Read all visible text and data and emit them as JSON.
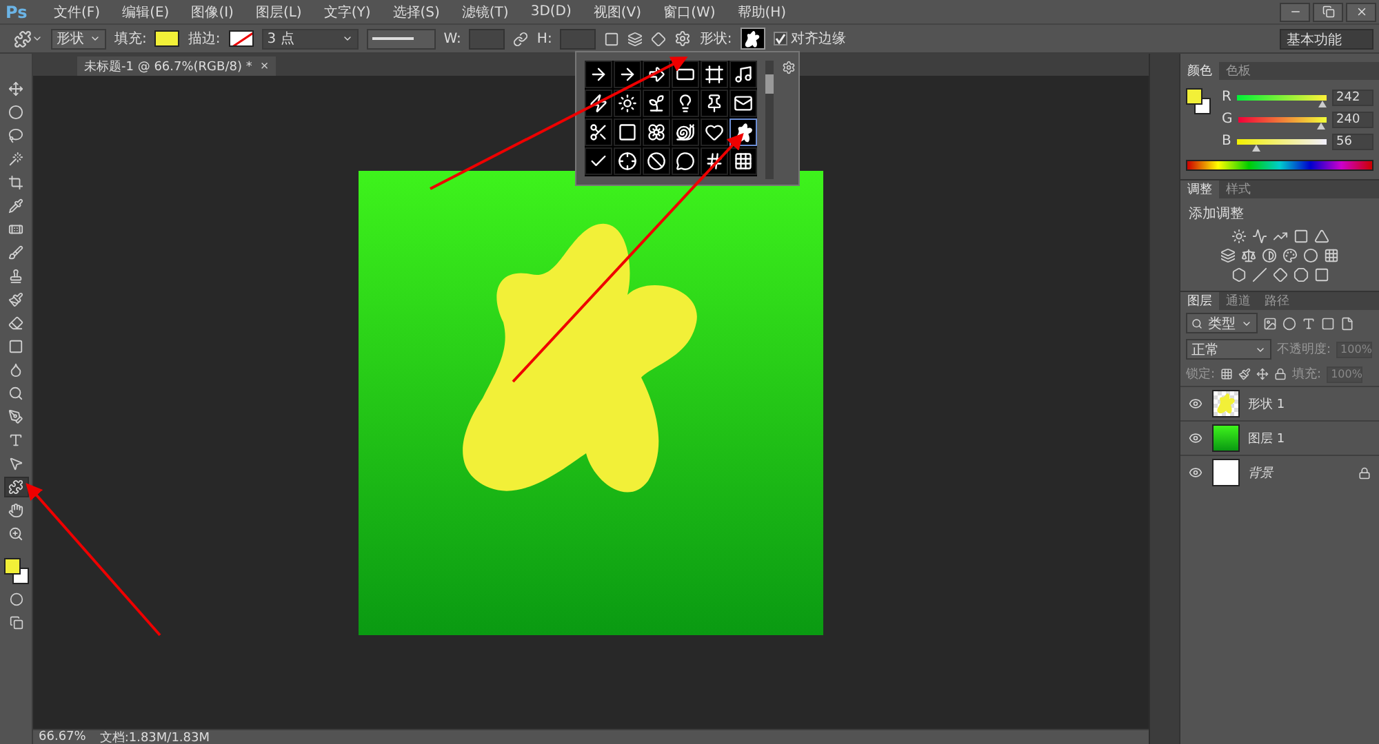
{
  "app_logo": "Ps",
  "menu": [
    "文件(F)",
    "编辑(E)",
    "图像(I)",
    "图层(L)",
    "文字(Y)",
    "选择(S)",
    "滤镜(T)",
    "3D(D)",
    "视图(V)",
    "窗口(W)",
    "帮助(H)"
  ],
  "options": {
    "mode": "形状",
    "fill_label": "填充:",
    "stroke_label": "描边:",
    "stroke_width": "3 点",
    "w_label": "W:",
    "h_label": "H:",
    "shape_label": "形状:",
    "align_edges": {
      "label": "对齐边缘",
      "checked": true
    },
    "workspace": "基本功能"
  },
  "document_tab": {
    "title": "未标题-1 @ 66.7%(RGB/8) *",
    "close": "×"
  },
  "tools": [
    {
      "selected": false
    },
    {
      "selected": false
    },
    {
      "selected": false
    },
    {
      "selected": false
    },
    {
      "selected": false
    },
    {
      "selected": false
    },
    {
      "selected": false
    },
    {
      "selected": false
    },
    {
      "selected": false
    },
    {
      "selected": false
    },
    {
      "selected": false
    },
    {
      "selected": false
    },
    {
      "selected": false
    },
    {
      "selected": false
    },
    {
      "selected": false
    },
    {
      "selected": false
    },
    {
      "selected": false
    },
    {
      "selected": true
    },
    {
      "selected": false
    },
    {
      "selected": false
    }
  ],
  "shape_picker": {
    "shapes": [
      {
        "selected": false
      },
      {
        "selected": false
      },
      {
        "selected": false
      },
      {
        "selected": false
      },
      {
        "selected": false
      },
      {
        "selected": false
      },
      {
        "selected": false
      },
      {
        "selected": false
      },
      {
        "selected": false
      },
      {
        "selected": false
      },
      {
        "selected": false
      },
      {
        "selected": false
      },
      {
        "selected": false
      },
      {
        "selected": false
      },
      {
        "selected": false
      },
      {
        "selected": false
      },
      {
        "selected": false
      },
      {
        "selected": true
      },
      {
        "selected": false
      },
      {
        "selected": false
      },
      {
        "selected": false
      },
      {
        "selected": false
      },
      {
        "selected": false
      },
      {
        "selected": false
      }
    ]
  },
  "color_panel": {
    "tabs": [
      {
        "label": "颜色",
        "selected": true
      },
      {
        "label": "色板",
        "selected": false
      }
    ],
    "channels": [
      {
        "name": "R",
        "value": "242",
        "level": 0.95
      },
      {
        "name": "G",
        "value": "240",
        "level": 0.94
      },
      {
        "name": "B",
        "value": "56",
        "level": 0.22
      }
    ]
  },
  "adjustments_panel": {
    "tabs": [
      {
        "label": "调整",
        "selected": true
      },
      {
        "label": "样式",
        "selected": false
      }
    ],
    "title": "添加调整"
  },
  "layers_panel": {
    "tabs": [
      {
        "label": "图层",
        "selected": true
      },
      {
        "label": "通道",
        "selected": false
      },
      {
        "label": "路径",
        "selected": false
      }
    ],
    "filter": "类型",
    "blend_mode": "正常",
    "opacity_label": "不透明度:",
    "opacity": "100%",
    "lock_label": "锁定:",
    "fill_label": "填充:",
    "fill": "100%",
    "layers": [
      {
        "name": "形状 1",
        "kind": "shape",
        "visible": true,
        "locked": false
      },
      {
        "name": "图层 1",
        "kind": "gradient",
        "visible": true,
        "locked": false
      },
      {
        "name": "背景",
        "kind": "background",
        "visible": true,
        "locked": true
      }
    ]
  },
  "status_bar": {
    "zoom": "66.67%",
    "document": "文档:1.83M/1.83M"
  }
}
